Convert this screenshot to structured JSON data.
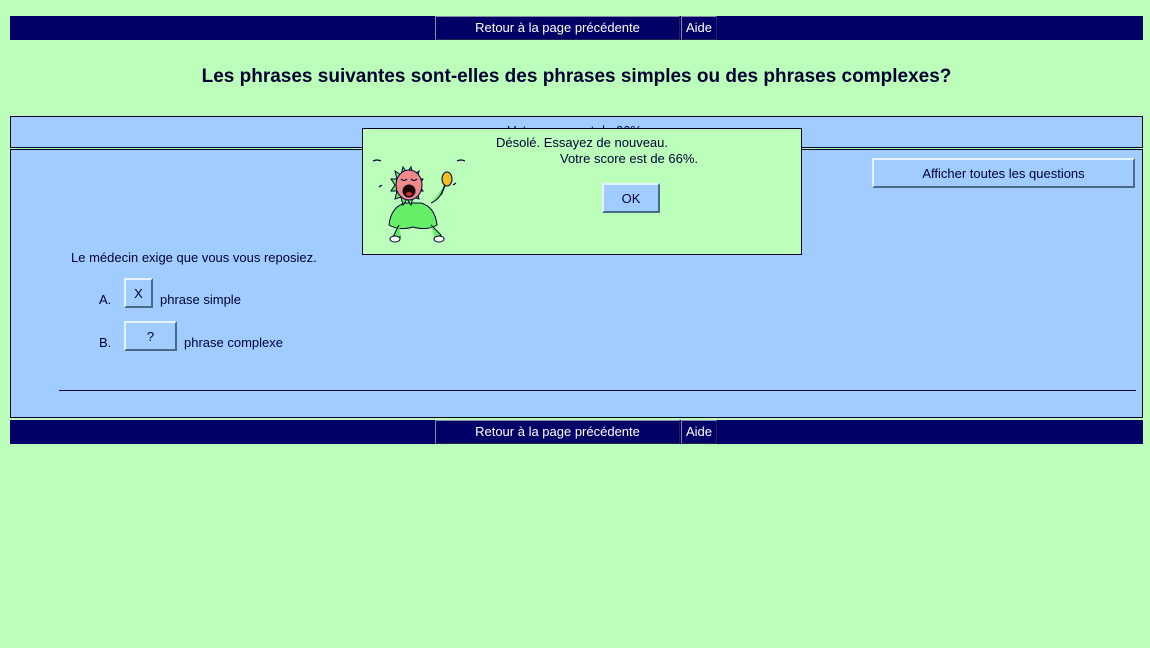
{
  "nav": {
    "back_label": "Retour à la page précédente",
    "help_label": "Aide"
  },
  "page": {
    "title": "Les phrases suivantes sont-elles des phrases simples ou des phrases complexes?"
  },
  "score_bar": {
    "text": "Votre score est de 66%."
  },
  "toolbar": {
    "show_all_label": "Afficher toutes les questions"
  },
  "question": {
    "text": "Le médecin exige que vous vous reposiez.",
    "answers": [
      {
        "letter": "A.",
        "button_label": "X",
        "label": "phrase simple"
      },
      {
        "letter": "B.",
        "button_label": "?",
        "label": "phrase complexe"
      }
    ]
  },
  "dialog": {
    "message": "Désolé. Essayez de nouveau.",
    "score": "Votre score est de 66%.",
    "ok_label": "OK",
    "image_icon": "crying-baby-icon"
  },
  "colors": {
    "background": "#bbffbb",
    "navbar": "#000066",
    "panel": "#a0ccff",
    "text": "#000033"
  }
}
